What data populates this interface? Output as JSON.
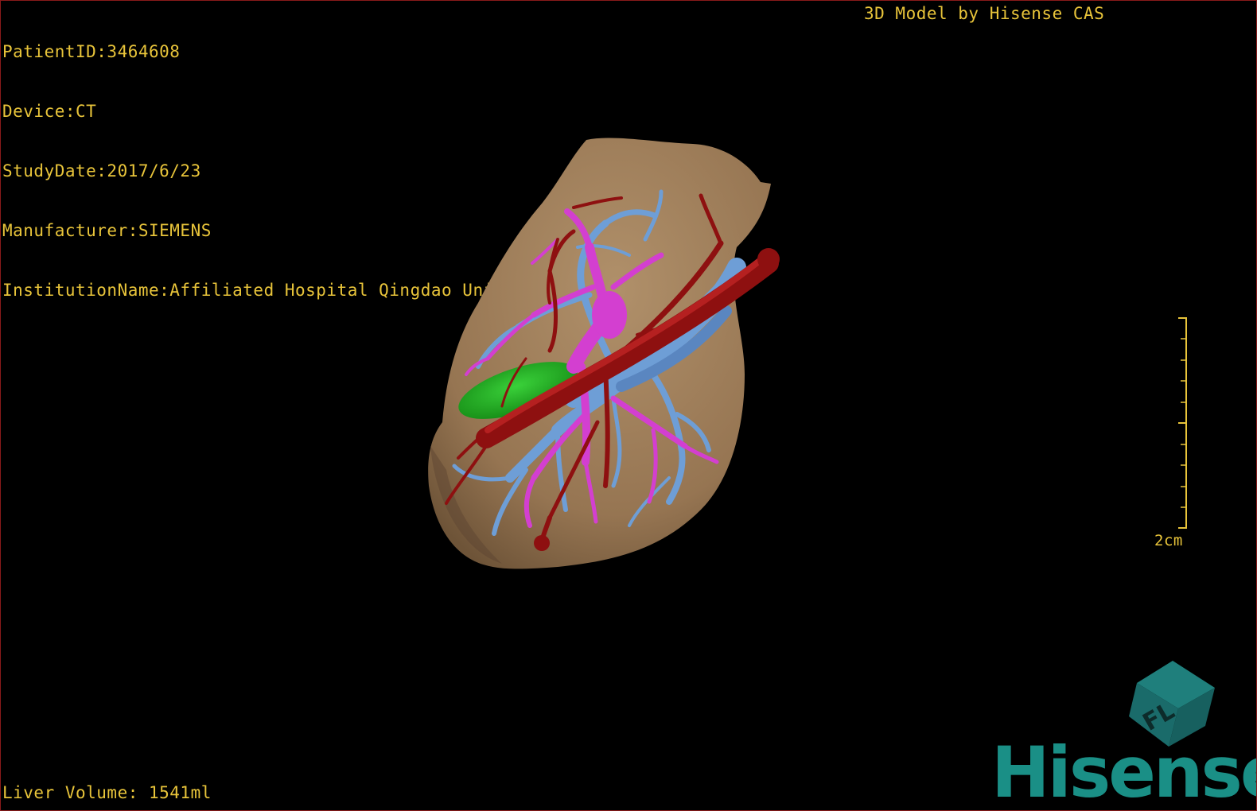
{
  "header": {
    "patient_id": "PatientID:3464608",
    "device": "Device:CT",
    "study_date": "StudyDate:2017/6/23",
    "manufacturer": "Manufacturer:SIEMENS",
    "institution": "InstitutionName:Affiliated Hospital Qingdao University-C"
  },
  "brand_caption": "3D Model by Hisense CAS",
  "footer": {
    "liver_volume": "Liver Volume: 1541ml"
  },
  "scale": {
    "label": "2cm"
  },
  "orientation_cube": {
    "face_letters": "FL"
  },
  "logo": {
    "text": "Hisense"
  },
  "colors": {
    "text": "#e8c43a",
    "liver": "#9c7b57",
    "hepatic_artery": "#8e1010",
    "portal_vein": "#d33fd0",
    "hepatic_vein": "#6e9ed6",
    "gallbladder": "#22b322",
    "brand": "#1a8f86"
  }
}
